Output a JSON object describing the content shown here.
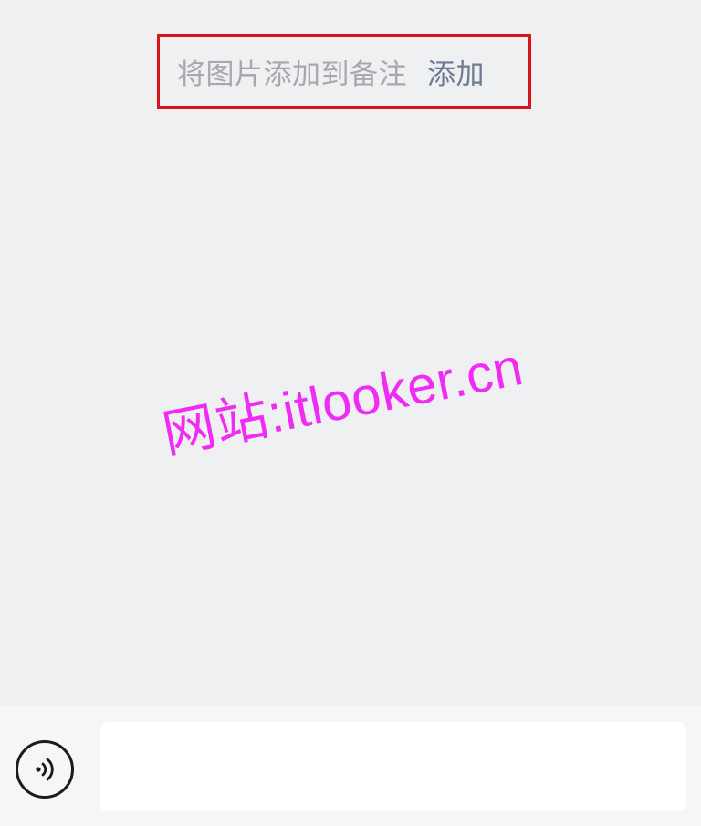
{
  "notice": {
    "text": "将图片添加到备注",
    "action_label": "添加"
  },
  "watermark": {
    "text": "网站:itlooker.cn"
  },
  "input_bar": {
    "voice_icon": "voice-icon",
    "input_value": "",
    "input_placeholder": ""
  },
  "colors": {
    "background": "#eff0f1",
    "highlight_border": "#d9141e",
    "notice_text": "#a6a8ab",
    "notice_link": "#6f7b93",
    "watermark": "#f02cf4"
  }
}
